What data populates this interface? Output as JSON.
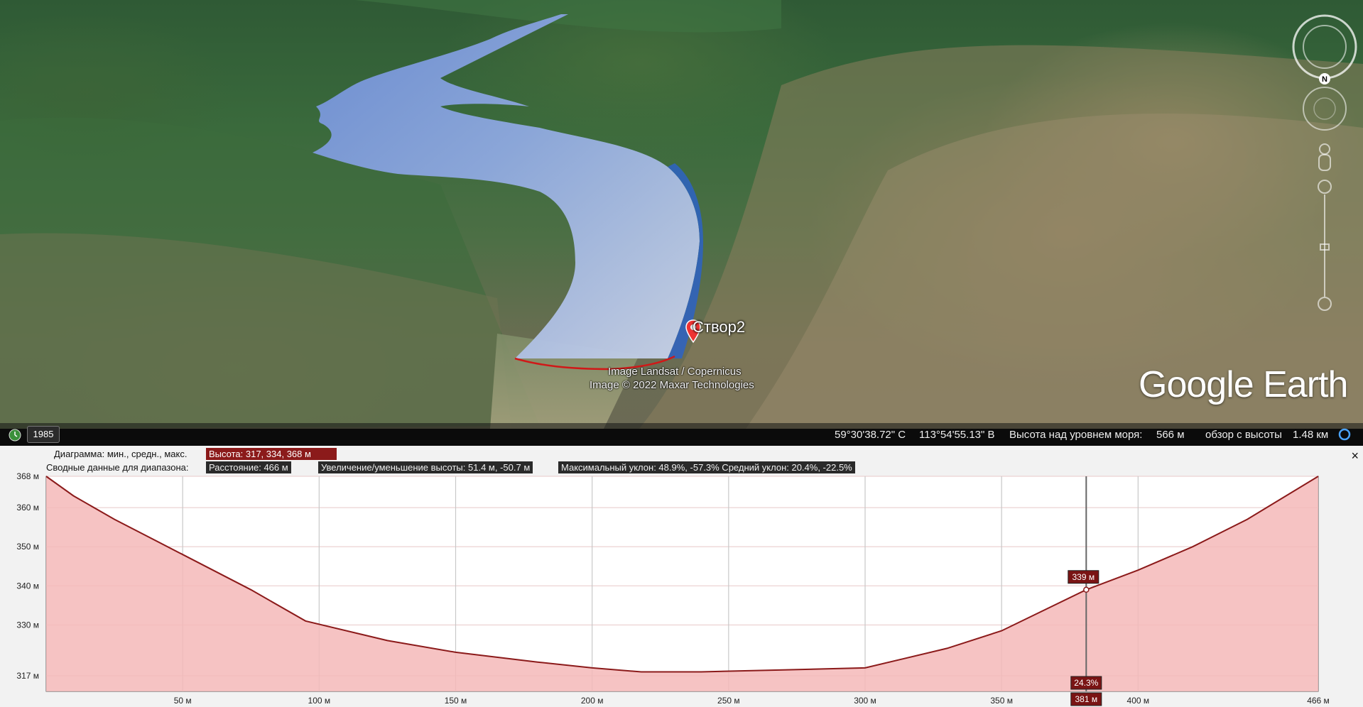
{
  "map": {
    "placemark_label": "Створ2",
    "attribution": [
      "Image Landsat / Copernicus",
      "Image © 2022 Maxar Technologies"
    ],
    "logo": "Google Earth",
    "compass_letter": "N",
    "icons": [
      "compass-ring-icon",
      "look-joystick-icon",
      "street-view-pegman-icon",
      "zoom-slider-icon",
      "placemark-pin-icon",
      "historical-imagery-clock-icon"
    ]
  },
  "status": {
    "year": "1985",
    "lat": "59°30'38.72\" С",
    "lon": "113°54'55.13\" В",
    "elev_label": "Высота над уровнем моря:",
    "elev_value": "566 м",
    "eye_label": "обзор с высоты",
    "eye_value": "1.48 км"
  },
  "profile": {
    "close": "×",
    "row1_label": "Диаграмма: мин., средн., макс.",
    "row1_value": "Высота: 317, 334, 368 м",
    "row2_label": "Сводные данные для диапазона:",
    "row2_distance": "Расстояние: 466 м",
    "row2_gain": "Увеличение/уменьшение высоты: 51.4 м, -50.7 м",
    "row2_slope": "Максимальный уклон: 48.9%, -57.3% Средний уклон: 20.4%, -22.5%",
    "cursor_elev": "339 м",
    "cursor_slope": "24.3%",
    "cursor_dist": "381 м"
  },
  "chart_data": {
    "type": "area",
    "xlabel": "",
    "ylabel": "",
    "xlim": [
      0,
      466
    ],
    "ylim": [
      313,
      368
    ],
    "y_ticks": [
      317,
      330,
      340,
      350,
      360,
      368
    ],
    "y_tick_labels": [
      "317 м",
      "330 м",
      "340 м",
      "350 м",
      "360 м",
      "368 м"
    ],
    "x_ticks": [
      50,
      100,
      150,
      200,
      250,
      300,
      350,
      400,
      466
    ],
    "x_tick_labels": [
      "50 м",
      "100 м",
      "150 м",
      "200 м",
      "250 м",
      "300 м",
      "350 м",
      "400 м",
      "466 м"
    ],
    "series": [
      {
        "values": [
          [
            0,
            368
          ],
          [
            10,
            363
          ],
          [
            25,
            357
          ],
          [
            50,
            348
          ],
          [
            75,
            339
          ],
          [
            95,
            331
          ],
          [
            125,
            326
          ],
          [
            150,
            323
          ],
          [
            180,
            320.5
          ],
          [
            200,
            319
          ],
          [
            218,
            318
          ],
          [
            240,
            318
          ],
          [
            270,
            318.5
          ],
          [
            300,
            319
          ],
          [
            330,
            324
          ],
          [
            350,
            328.5
          ],
          [
            381,
            339
          ],
          [
            400,
            344
          ],
          [
            420,
            350
          ],
          [
            440,
            357
          ],
          [
            466,
            368
          ]
        ],
        "color": "#8b1a1a",
        "fill": "#f5b8b8"
      }
    ],
    "cursor_x": 381,
    "cursor_y": 339,
    "grid": true
  }
}
